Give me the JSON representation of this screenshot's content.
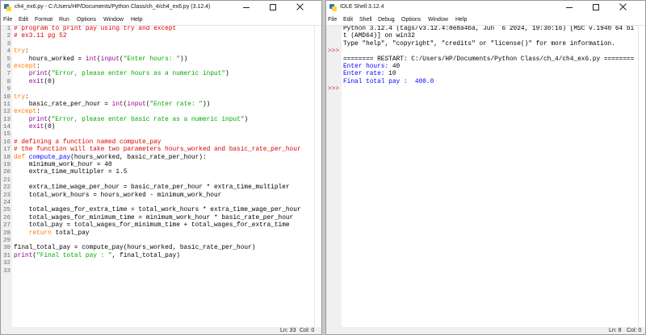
{
  "colors": {
    "plain": "#000000",
    "comment": "#dd0000",
    "keyword": "#ff7700",
    "builtin": "#900090",
    "string": "#00aa00",
    "definition": "#0000ff",
    "console": "#000000",
    "stdout": "#0000ff",
    "stdin": "#000000",
    "prompt": "#c03030"
  },
  "icons": {
    "app": "idle-icon",
    "minimize": "minimize-icon",
    "maximize": "maximize-icon",
    "close": "close-icon"
  },
  "editor": {
    "title": "ch4_ex6.py - C:/Users/HP/Documents/Python Class/ch_4/ch4_ex6.py (3.12.4)",
    "menu": [
      "File",
      "Edit",
      "Format",
      "Run",
      "Options",
      "Window",
      "Help"
    ],
    "line_numbers": [
      1,
      2,
      3,
      4,
      5,
      6,
      7,
      8,
      9,
      10,
      11,
      12,
      13,
      14,
      15,
      16,
      17,
      18,
      19,
      20,
      21,
      22,
      23,
      24,
      25,
      26,
      27,
      28,
      29,
      30,
      31,
      32,
      33
    ],
    "lines": [
      [
        {
          "t": "# program to print pay using try and except",
          "k": "comment"
        }
      ],
      [
        {
          "t": "# ex3.11 pg 52",
          "k": "comment"
        }
      ],
      [],
      [
        {
          "t": "try",
          "k": "keyword"
        },
        {
          "t": ":",
          "k": "plain"
        }
      ],
      [
        {
          "t": "    hours_worked = ",
          "k": "plain"
        },
        {
          "t": "int",
          "k": "builtin"
        },
        {
          "t": "(",
          "k": "plain"
        },
        {
          "t": "input",
          "k": "builtin"
        },
        {
          "t": "(",
          "k": "plain"
        },
        {
          "t": "\"Enter hours: \"",
          "k": "string"
        },
        {
          "t": "))",
          "k": "plain"
        }
      ],
      [
        {
          "t": "except",
          "k": "keyword"
        },
        {
          "t": ":",
          "k": "plain"
        }
      ],
      [
        {
          "t": "    ",
          "k": "plain"
        },
        {
          "t": "print",
          "k": "builtin"
        },
        {
          "t": "(",
          "k": "plain"
        },
        {
          "t": "\"Error, please enter hours as a numeric input\"",
          "k": "string"
        },
        {
          "t": ")",
          "k": "plain"
        }
      ],
      [
        {
          "t": "    ",
          "k": "plain"
        },
        {
          "t": "exit",
          "k": "builtin"
        },
        {
          "t": "(0)",
          "k": "plain"
        }
      ],
      [],
      [
        {
          "t": "try",
          "k": "keyword"
        },
        {
          "t": ":",
          "k": "plain"
        }
      ],
      [
        {
          "t": "    basic_rate_per_hour = ",
          "k": "plain"
        },
        {
          "t": "int",
          "k": "builtin"
        },
        {
          "t": "(",
          "k": "plain"
        },
        {
          "t": "input",
          "k": "builtin"
        },
        {
          "t": "(",
          "k": "plain"
        },
        {
          "t": "\"Enter rate: \"",
          "k": "string"
        },
        {
          "t": "))",
          "k": "plain"
        }
      ],
      [
        {
          "t": "except",
          "k": "keyword"
        },
        {
          "t": ":",
          "k": "plain"
        }
      ],
      [
        {
          "t": "    ",
          "k": "plain"
        },
        {
          "t": "print",
          "k": "builtin"
        },
        {
          "t": "(",
          "k": "plain"
        },
        {
          "t": "\"Error, please enter basic rate as a numeric input\"",
          "k": "string"
        },
        {
          "t": ")",
          "k": "plain"
        }
      ],
      [
        {
          "t": "    ",
          "k": "plain"
        },
        {
          "t": "exit",
          "k": "builtin"
        },
        {
          "t": "(0)",
          "k": "plain"
        }
      ],
      [],
      [
        {
          "t": "# defining a function named compute_pay",
          "k": "comment"
        }
      ],
      [
        {
          "t": "# the function will take two parameters hours_worked and basic_rate_per_hour",
          "k": "comment"
        }
      ],
      [
        {
          "t": "def",
          "k": "keyword"
        },
        {
          "t": " ",
          "k": "plain"
        },
        {
          "t": "compute_pay",
          "k": "definition"
        },
        {
          "t": "(hours_worked, basic_rate_per_hour):",
          "k": "plain"
        }
      ],
      [
        {
          "t": "    minimum_work_hour = 40",
          "k": "plain"
        }
      ],
      [
        {
          "t": "    extra_time_multipler = 1.5",
          "k": "plain"
        }
      ],
      [],
      [
        {
          "t": "    extra_time_wage_per_hour = basic_rate_per_hour * extra_time_multipler",
          "k": "plain"
        }
      ],
      [
        {
          "t": "    total_work_hours = hours_worked - minimum_work_hour",
          "k": "plain"
        }
      ],
      [],
      [
        {
          "t": "    total_wages_for_extra_time = total_work_hours * extra_time_wage_per_hour",
          "k": "plain"
        }
      ],
      [
        {
          "t": "    total_wages_for_minimum_time = minimum_work_hour * basic_rate_per_hour",
          "k": "plain"
        }
      ],
      [
        {
          "t": "    total_pay = total_wages_for_minimum_time + total_wages_for_extra_time",
          "k": "plain"
        }
      ],
      [
        {
          "t": "    ",
          "k": "plain"
        },
        {
          "t": "return",
          "k": "keyword"
        },
        {
          "t": " total_pay",
          "k": "plain"
        }
      ],
      [],
      [
        {
          "t": "final_total_pay = compute_pay(hours_worked, basic_rate_per_hour)",
          "k": "plain"
        }
      ],
      [
        {
          "t": "print",
          "k": "builtin"
        },
        {
          "t": "(",
          "k": "plain"
        },
        {
          "t": "\"Final total pay : \"",
          "k": "string"
        },
        {
          "t": ", final_total_pay)",
          "k": "plain"
        }
      ],
      [],
      []
    ],
    "status": {
      "line": "Ln: 33",
      "col": "Col: 0"
    }
  },
  "shell": {
    "title": "IDLE Shell 3.12.4",
    "menu": [
      "File",
      "Edit",
      "Shell",
      "Debug",
      "Options",
      "Window",
      "Help"
    ],
    "lines": [
      {
        "prompt": "",
        "segs": [
          {
            "t": "Python 3.12.4 (tags/v3.12.4:8e8a4ba, Jun  6 2024, 19:30:16) [MSC v.1940 64 bi",
            "k": "console"
          }
        ]
      },
      {
        "prompt": "",
        "segs": [
          {
            "t": "t (AMD64)] on win32",
            "k": "console"
          }
        ]
      },
      {
        "prompt": "",
        "segs": [
          {
            "t": "Type \"help\", \"copyright\", \"credits\" or \"license()\" for more information.",
            "k": "console"
          }
        ]
      },
      {
        "prompt": ">>>",
        "segs": []
      },
      {
        "prompt": "",
        "segs": [
          {
            "t": "======== RESTART: C:/Users/HP/Documents/Python Class/ch_4/ch4_ex6.py ========",
            "k": "console"
          }
        ]
      },
      {
        "prompt": "",
        "segs": [
          {
            "t": "Enter hours: ",
            "k": "stdout"
          },
          {
            "t": "40",
            "k": "stdin"
          }
        ]
      },
      {
        "prompt": "",
        "segs": [
          {
            "t": "Enter rate: ",
            "k": "stdout"
          },
          {
            "t": "10",
            "k": "stdin"
          }
        ]
      },
      {
        "prompt": "",
        "segs": [
          {
            "t": "Final total pay :  400.0",
            "k": "stdout"
          }
        ]
      },
      {
        "prompt": ">>>",
        "segs": []
      }
    ],
    "status": {
      "line": "Ln: 8",
      "col": "Col: 0"
    }
  }
}
